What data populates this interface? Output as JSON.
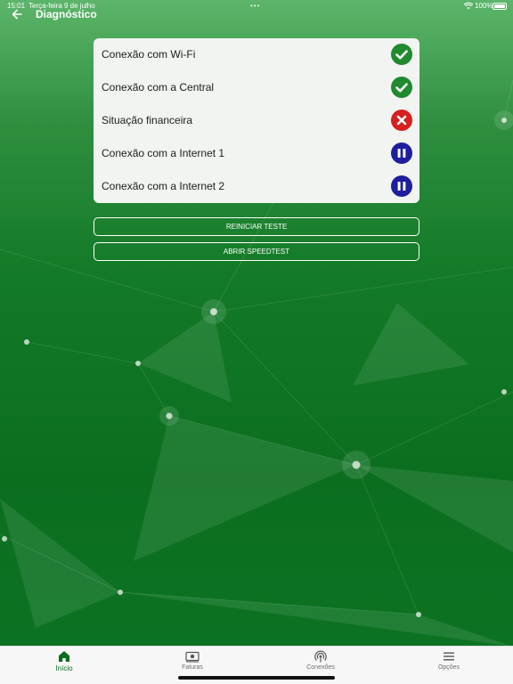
{
  "status_bar": {
    "time": "15:01",
    "date": "Terça-feira 9 de julho",
    "battery": "100%"
  },
  "header": {
    "title": "Diagnóstico"
  },
  "diagnostics": [
    {
      "label": "Conexão com Wi-Fi",
      "status": "ok",
      "icon": "check-circle-icon",
      "color": "#1f8a2e"
    },
    {
      "label": "Conexão com a Central",
      "status": "ok",
      "icon": "check-circle-icon",
      "color": "#1f8a2e"
    },
    {
      "label": "Situação financeira",
      "status": "error",
      "icon": "x-circle-icon",
      "color": "#d61f1f"
    },
    {
      "label": "Conexão com a Internet 1",
      "status": "paused",
      "icon": "pause-circle-icon",
      "color": "#1d1f9e"
    },
    {
      "label": "Conexão com a Internet 2",
      "status": "paused",
      "icon": "pause-circle-icon",
      "color": "#1d1f9e"
    }
  ],
  "actions": {
    "restart_label": "REINICIAR TESTE",
    "speedtest_label": "ABRIR SPEEDTEST"
  },
  "bottom_nav": [
    {
      "label": "Início",
      "icon": "home-icon",
      "active": true
    },
    {
      "label": "Faturas",
      "icon": "money-icon",
      "active": false
    },
    {
      "label": "Conexões",
      "icon": "signal-icon",
      "active": false
    },
    {
      "label": "Opções",
      "icon": "menu-icon",
      "active": false
    }
  ],
  "colors": {
    "brand_green": "#0f6b1f",
    "ok": "#1f8a2e",
    "error": "#d61f1f",
    "paused": "#1d1f9e"
  }
}
